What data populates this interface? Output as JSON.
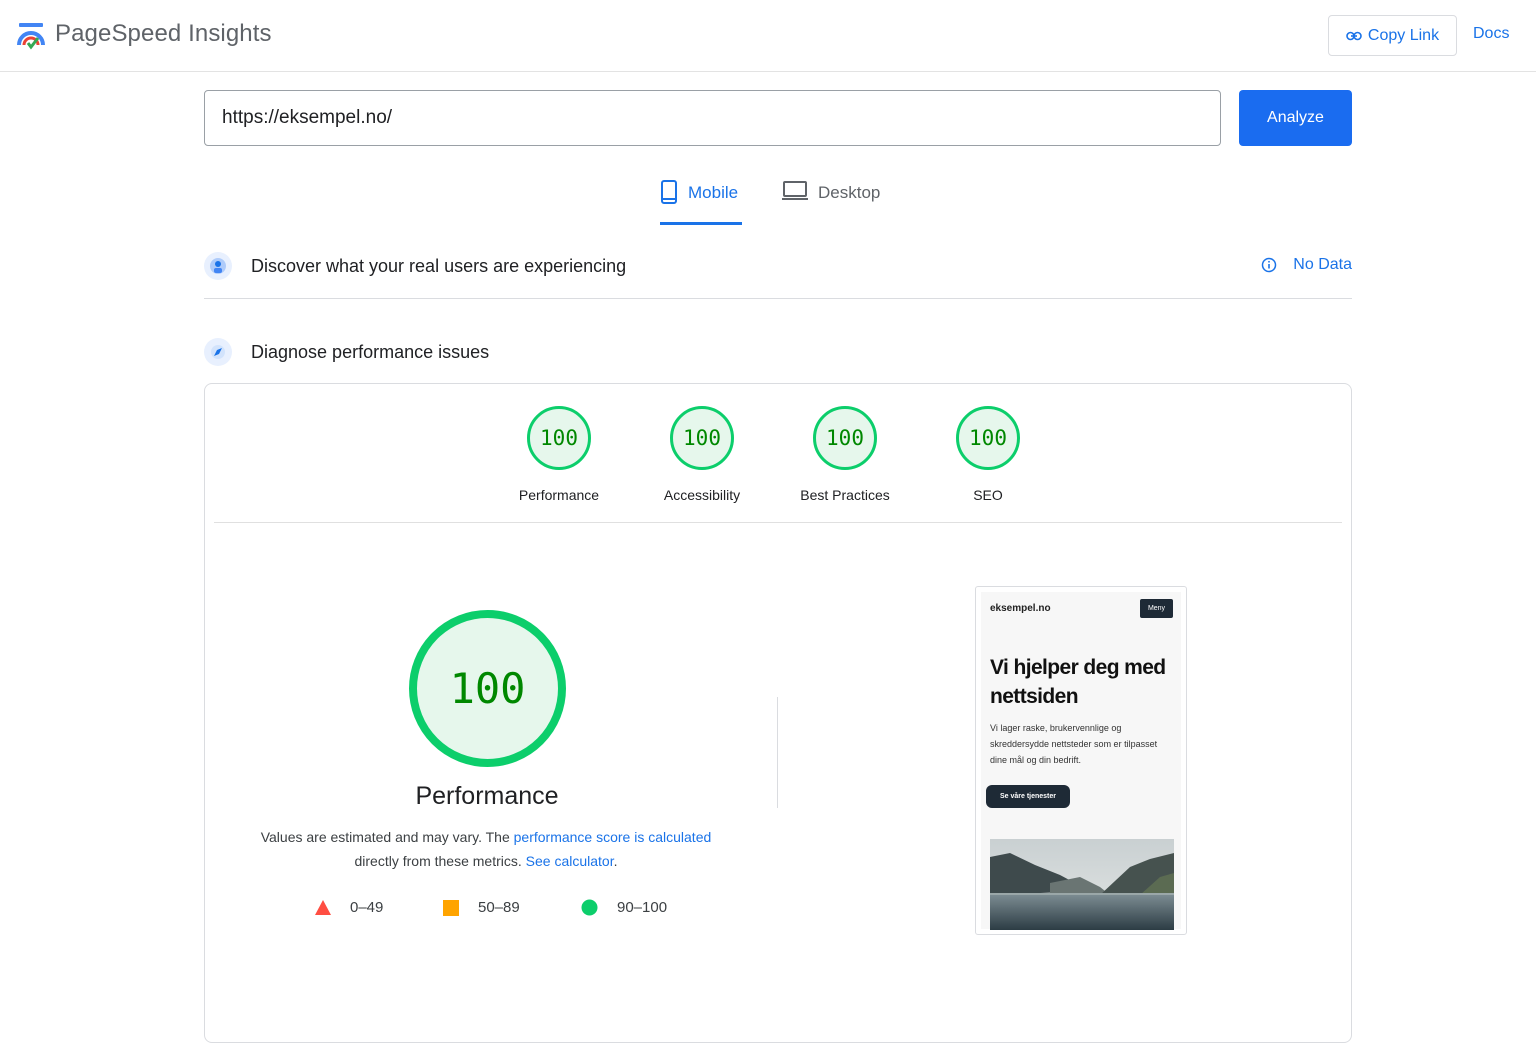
{
  "header": {
    "title": "PageSpeed Insights",
    "copy_link": "Copy Link",
    "docs": "Docs"
  },
  "search": {
    "url": "https://eksempel.no/",
    "analyze": "Analyze"
  },
  "tabs": [
    {
      "label": "Mobile",
      "active": true
    },
    {
      "label": "Desktop",
      "active": false
    }
  ],
  "field_data": {
    "title": "Discover what your real users are experiencing",
    "status": "No Data"
  },
  "lab_data": {
    "title": "Diagnose performance issues"
  },
  "scores": [
    {
      "label": "Performance",
      "value": "100"
    },
    {
      "label": "Accessibility",
      "value": "100"
    },
    {
      "label": "Best Practices",
      "value": "100"
    },
    {
      "label": "SEO",
      "value": "100"
    }
  ],
  "performance": {
    "score": "100",
    "label": "Performance",
    "note_1": "Values are estimated and may vary. The ",
    "note_link_1": "performance score is calculated",
    "note_2": "directly from these metrics. ",
    "note_link_2": "See calculator",
    "note_end": "."
  },
  "legend": {
    "fail": "0–49",
    "average": "50–89",
    "pass": "90–100"
  },
  "colors": {
    "pass": "#0cce6b",
    "average": "#ffa400",
    "fail": "#ff4e42",
    "accent": "#1a73e8",
    "primary_button": "#1a6cf0"
  },
  "preview": {
    "site": "eksempel.no",
    "menu": "Meny",
    "heading": "Vi hjelper deg med nettsiden",
    "body": "Vi lager raske, brukervennlige og skreddersydde nettsteder som er tilpasset dine mål og din bedrift.",
    "button": "Se våre tjenester"
  }
}
